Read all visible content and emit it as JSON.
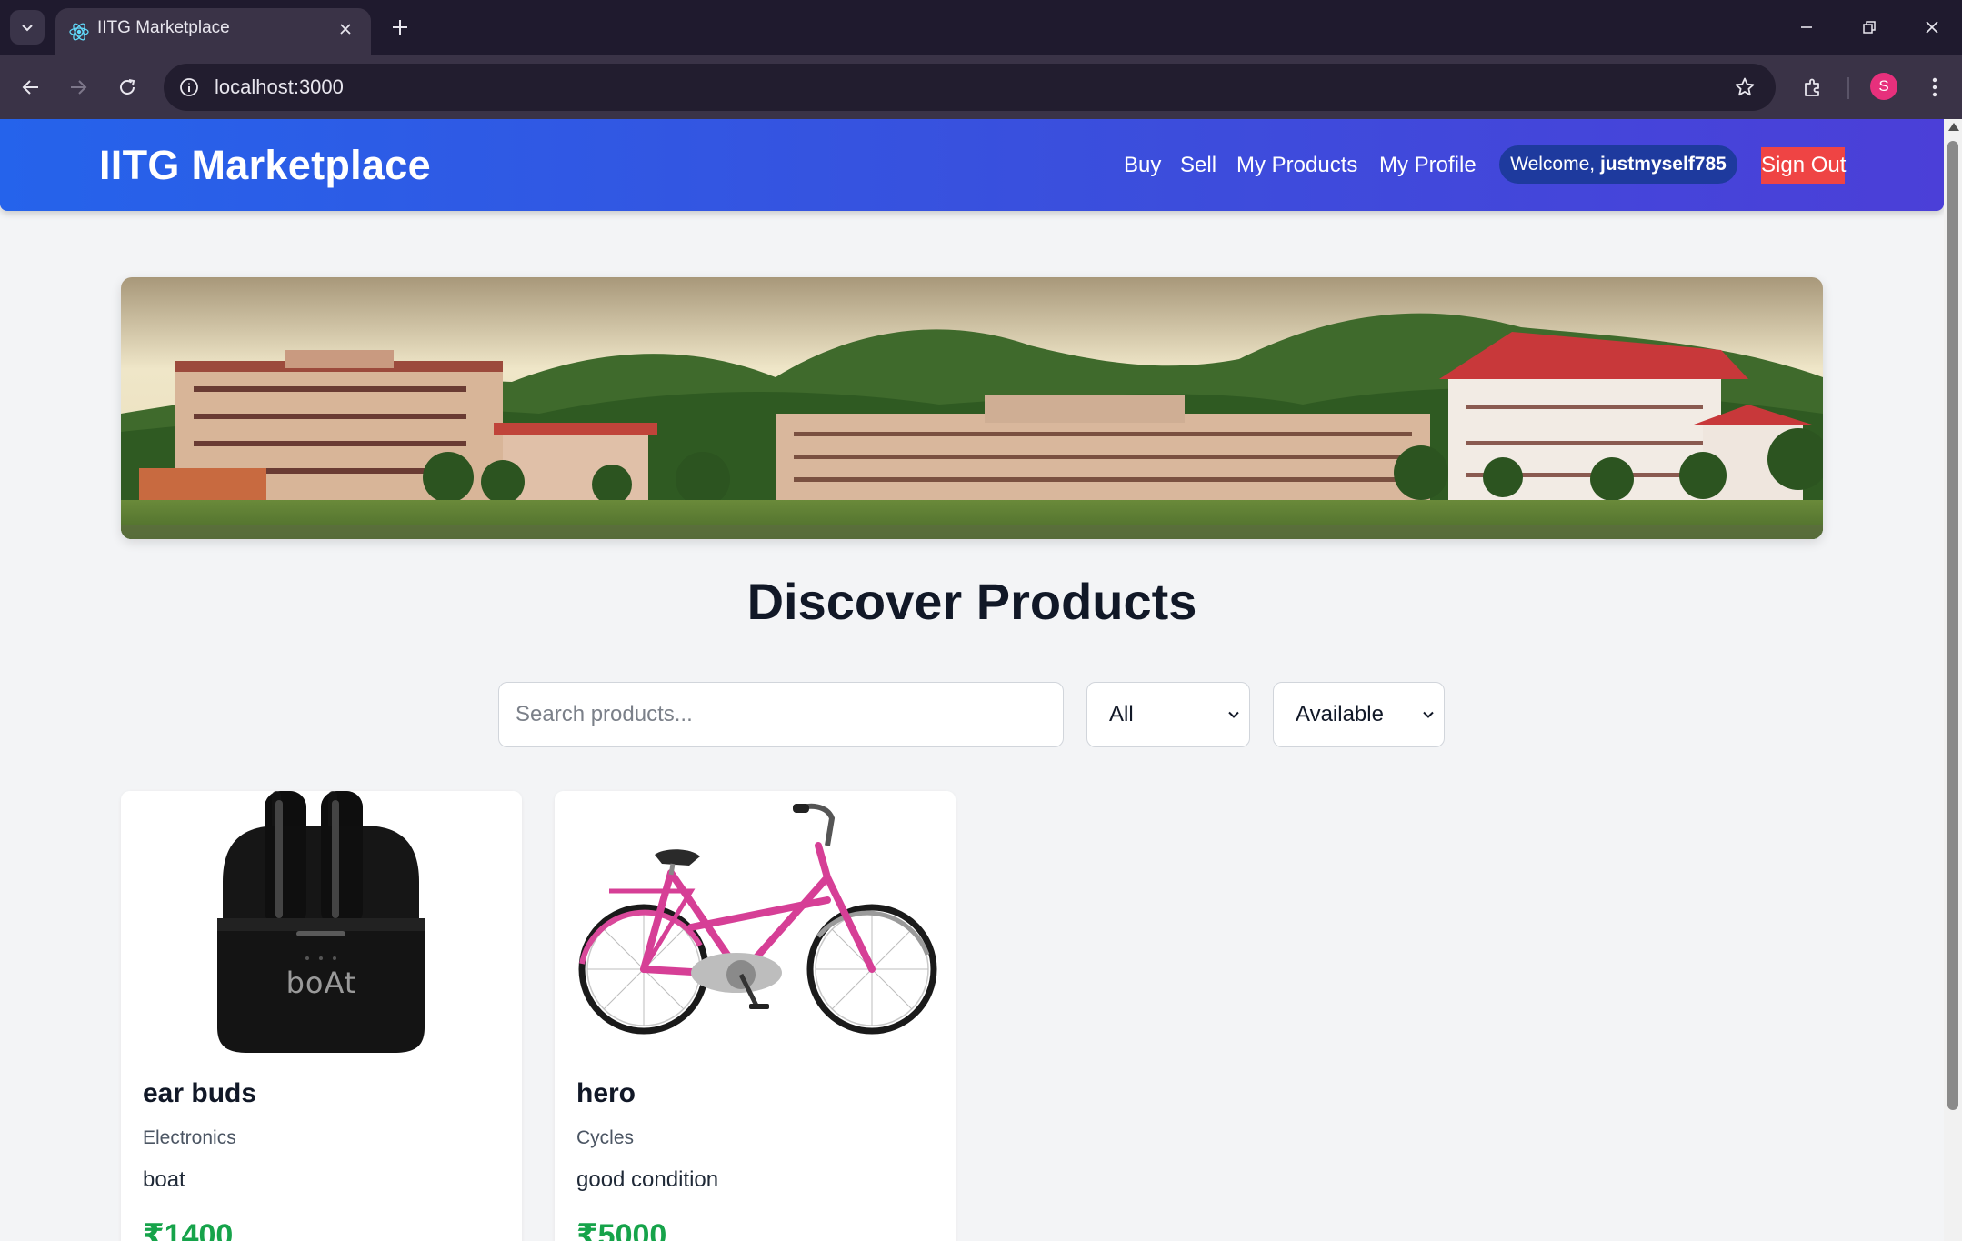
{
  "browser": {
    "tab_title": "IITG Marketplace",
    "url": "localhost:3000",
    "profile_initial": "S"
  },
  "header": {
    "brand": "IITG Marketplace",
    "nav": [
      "Buy",
      "Sell",
      "My Products",
      "My Profile"
    ],
    "welcome_prefix": "Welcome, ",
    "username": "justmyself785",
    "signout_label": "Sign Out"
  },
  "main": {
    "heading": "Discover Products",
    "search": {
      "placeholder": "Search products..."
    },
    "category_filter": {
      "selected": "All"
    },
    "status_filter": {
      "selected": "Available"
    },
    "products": [
      {
        "title": "ear buds",
        "category": "Electronics",
        "description": "boat",
        "price": "₹1400",
        "brand_mark": "boAt"
      },
      {
        "title": "hero",
        "category": "Cycles",
        "description": "good condition",
        "price": "₹5000"
      }
    ]
  },
  "colors": {
    "header_gradient_start": "#2563eb",
    "header_gradient_end": "#4b3fd8",
    "signout_bg": "#ef4444",
    "price": "#16a34a",
    "page_bg": "#f3f4f6"
  }
}
